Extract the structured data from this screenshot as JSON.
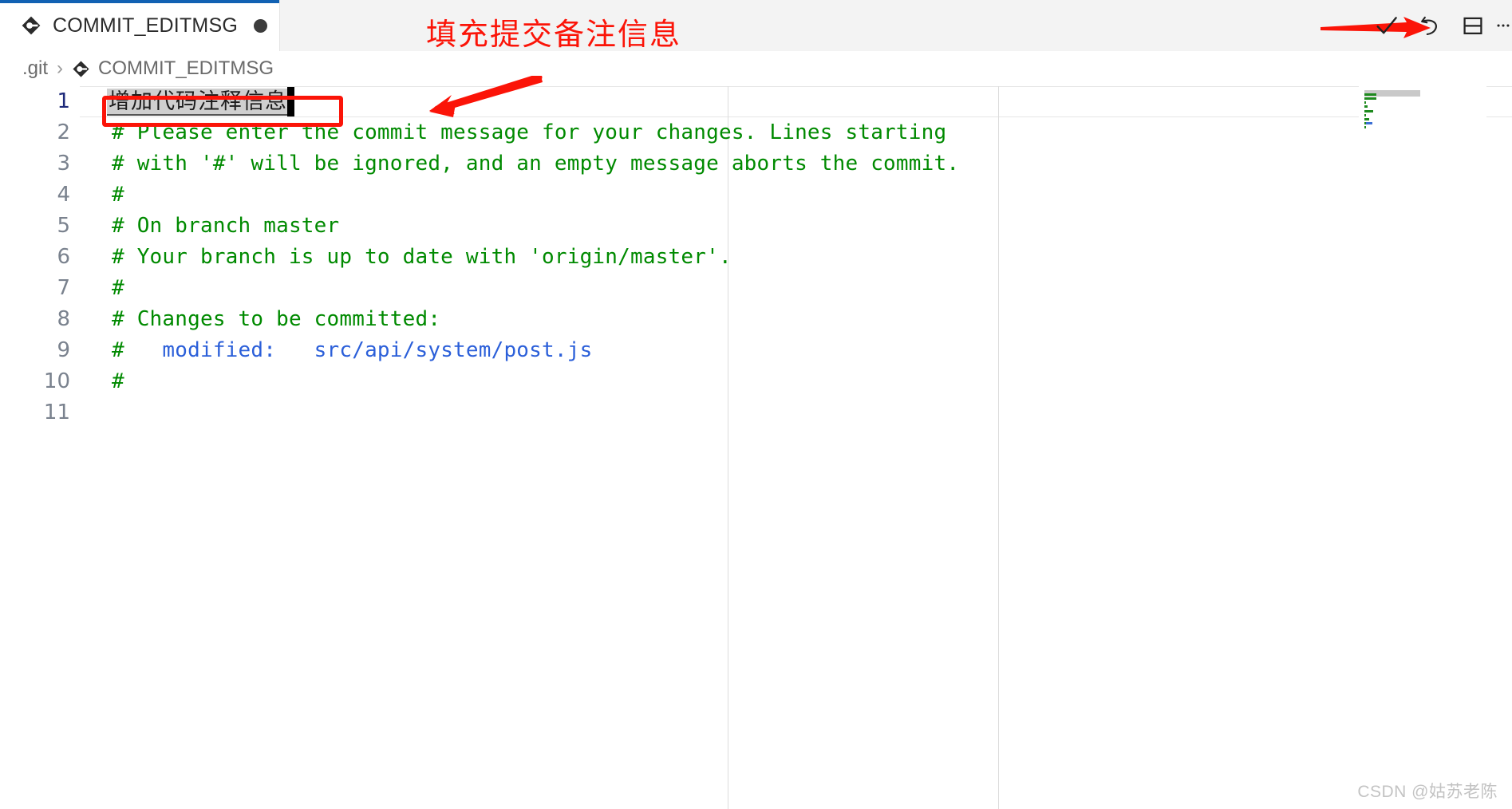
{
  "window": {
    "accent_color": "#1161b3",
    "annotation_color": "#fb1408",
    "comment_color": "#008a00",
    "path_color": "#2b5fd9"
  },
  "tabbar": {
    "tabs": [
      {
        "label": "COMMIT_EDITMSG",
        "icon": "git-commit-file-icon",
        "dirty": true,
        "active": true
      }
    ],
    "annotation": "填充提交备注信息"
  },
  "toolbar": {
    "items": [
      {
        "name": "accept-commit-button",
        "icon": "check-icon",
        "title": "提交"
      },
      {
        "name": "discard-changes-button",
        "icon": "undo-arrow-icon",
        "title": "放弃"
      },
      {
        "name": "split-editor-button",
        "icon": "split-editor-icon",
        "title": "拆分编辑器"
      },
      {
        "name": "more-actions-button",
        "icon": "ellipsis-icon",
        "title": "更多操作"
      }
    ]
  },
  "breadcrumb": {
    "items": [
      {
        "label": ".git",
        "icon": null
      },
      {
        "label": "COMMIT_EDITMSG",
        "icon": "git-commit-file-icon"
      }
    ],
    "separator": "›"
  },
  "editor": {
    "composition_text": "增加代码注释信息",
    "active_line": 1,
    "line_numbers": [
      "1",
      "2",
      "3",
      "4",
      "5",
      "6",
      "7",
      "8",
      "9",
      "10",
      "11"
    ],
    "lines": [
      {
        "n": 1,
        "segments": []
      },
      {
        "n": 2,
        "segments": [
          {
            "text": "# Please enter the commit message for your changes. Lines starting",
            "style": "comment"
          }
        ]
      },
      {
        "n": 3,
        "segments": [
          {
            "text": "# with '#' will be ignored, and an empty message aborts the commit.",
            "style": "comment"
          }
        ]
      },
      {
        "n": 4,
        "segments": [
          {
            "text": "#",
            "style": "comment"
          }
        ]
      },
      {
        "n": 5,
        "segments": [
          {
            "text": "# On branch master",
            "style": "comment"
          }
        ]
      },
      {
        "n": 6,
        "segments": [
          {
            "text": "# Your branch is up to date with 'origin/master'.",
            "style": "comment"
          }
        ]
      },
      {
        "n": 7,
        "segments": [
          {
            "text": "#",
            "style": "comment"
          }
        ]
      },
      {
        "n": 8,
        "segments": [
          {
            "text": "# Changes to be committed:",
            "style": "comment"
          }
        ]
      },
      {
        "n": 9,
        "segments": [
          {
            "text": "#",
            "style": "comment"
          },
          {
            "text": "   modified:   src/api/system/post.js",
            "style": "path"
          }
        ]
      },
      {
        "n": 10,
        "segments": [
          {
            "text": "#",
            "style": "comment"
          }
        ]
      },
      {
        "n": 11,
        "segments": []
      }
    ]
  },
  "watermark": "CSDN @姑苏老陈"
}
